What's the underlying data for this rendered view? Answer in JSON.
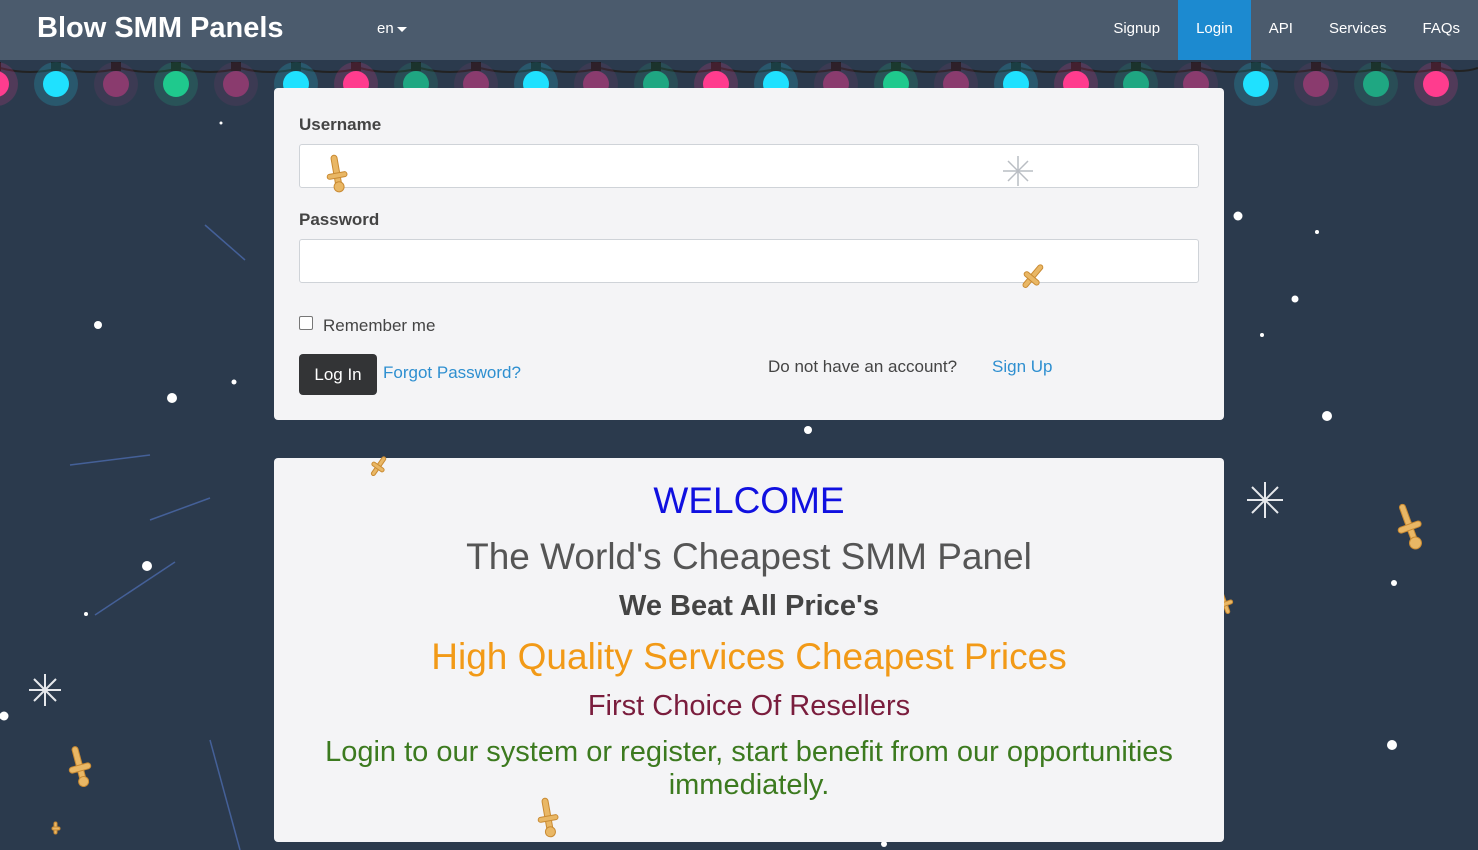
{
  "navbar": {
    "brand": "Blow SMM Panels",
    "language": "en",
    "links": [
      {
        "label": "Signup"
      },
      {
        "label": "Login",
        "active": true
      },
      {
        "label": "API"
      },
      {
        "label": "Services"
      },
      {
        "label": "FAQs"
      }
    ]
  },
  "login": {
    "username_label": "Username",
    "username_value": "",
    "password_label": "Password",
    "password_value": "",
    "remember_label": "Remember me",
    "login_button": "Log In",
    "forgot_link": "Forgot Password?",
    "no_account_text": "Do not have an account?",
    "signup_link": "Sign Up"
  },
  "welcome": {
    "line1": "WELCOME",
    "line2": "The World's Cheapest SMM Panel",
    "line3": "We Beat All Price's",
    "line4": "High Quality Services Cheapest Prices",
    "line5": "First Choice Of Resellers",
    "line6": "Login to our system or register, start benefit from our opportunities immediately."
  },
  "colors": {
    "background": "#2b3a4d",
    "navbar": "#4b5b6d",
    "active_nav": "#1c8ad0",
    "panel": "#f4f4f6",
    "welcome": "#1010e0",
    "accent_orange": "#f29a17",
    "resellers": "#7a1d3d",
    "login_green": "#3c7a1f"
  },
  "icons": {
    "lang_caret": "caret-down-icon",
    "lights": "christmas-lights-decoration",
    "snowflake": "snowflake-icon",
    "sparkler": "sparkler-icon"
  }
}
